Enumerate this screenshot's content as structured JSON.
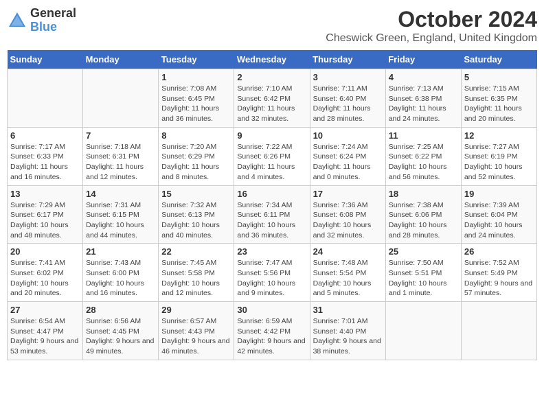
{
  "header": {
    "logo": {
      "text_general": "General",
      "text_blue": "Blue"
    },
    "title": "October 2024",
    "subtitle": "Cheswick Green, England, United Kingdom"
  },
  "calendar": {
    "days_of_week": [
      "Sunday",
      "Monday",
      "Tuesday",
      "Wednesday",
      "Thursday",
      "Friday",
      "Saturday"
    ],
    "weeks": [
      [
        {
          "day": "",
          "content": ""
        },
        {
          "day": "",
          "content": ""
        },
        {
          "day": "1",
          "content": "Sunrise: 7:08 AM\nSunset: 6:45 PM\nDaylight: 11 hours and 36 minutes."
        },
        {
          "day": "2",
          "content": "Sunrise: 7:10 AM\nSunset: 6:42 PM\nDaylight: 11 hours and 32 minutes."
        },
        {
          "day": "3",
          "content": "Sunrise: 7:11 AM\nSunset: 6:40 PM\nDaylight: 11 hours and 28 minutes."
        },
        {
          "day": "4",
          "content": "Sunrise: 7:13 AM\nSunset: 6:38 PM\nDaylight: 11 hours and 24 minutes."
        },
        {
          "day": "5",
          "content": "Sunrise: 7:15 AM\nSunset: 6:35 PM\nDaylight: 11 hours and 20 minutes."
        }
      ],
      [
        {
          "day": "6",
          "content": "Sunrise: 7:17 AM\nSunset: 6:33 PM\nDaylight: 11 hours and 16 minutes."
        },
        {
          "day": "7",
          "content": "Sunrise: 7:18 AM\nSunset: 6:31 PM\nDaylight: 11 hours and 12 minutes."
        },
        {
          "day": "8",
          "content": "Sunrise: 7:20 AM\nSunset: 6:29 PM\nDaylight: 11 hours and 8 minutes."
        },
        {
          "day": "9",
          "content": "Sunrise: 7:22 AM\nSunset: 6:26 PM\nDaylight: 11 hours and 4 minutes."
        },
        {
          "day": "10",
          "content": "Sunrise: 7:24 AM\nSunset: 6:24 PM\nDaylight: 11 hours and 0 minutes."
        },
        {
          "day": "11",
          "content": "Sunrise: 7:25 AM\nSunset: 6:22 PM\nDaylight: 10 hours and 56 minutes."
        },
        {
          "day": "12",
          "content": "Sunrise: 7:27 AM\nSunset: 6:19 PM\nDaylight: 10 hours and 52 minutes."
        }
      ],
      [
        {
          "day": "13",
          "content": "Sunrise: 7:29 AM\nSunset: 6:17 PM\nDaylight: 10 hours and 48 minutes."
        },
        {
          "day": "14",
          "content": "Sunrise: 7:31 AM\nSunset: 6:15 PM\nDaylight: 10 hours and 44 minutes."
        },
        {
          "day": "15",
          "content": "Sunrise: 7:32 AM\nSunset: 6:13 PM\nDaylight: 10 hours and 40 minutes."
        },
        {
          "day": "16",
          "content": "Sunrise: 7:34 AM\nSunset: 6:11 PM\nDaylight: 10 hours and 36 minutes."
        },
        {
          "day": "17",
          "content": "Sunrise: 7:36 AM\nSunset: 6:08 PM\nDaylight: 10 hours and 32 minutes."
        },
        {
          "day": "18",
          "content": "Sunrise: 7:38 AM\nSunset: 6:06 PM\nDaylight: 10 hours and 28 minutes."
        },
        {
          "day": "19",
          "content": "Sunrise: 7:39 AM\nSunset: 6:04 PM\nDaylight: 10 hours and 24 minutes."
        }
      ],
      [
        {
          "day": "20",
          "content": "Sunrise: 7:41 AM\nSunset: 6:02 PM\nDaylight: 10 hours and 20 minutes."
        },
        {
          "day": "21",
          "content": "Sunrise: 7:43 AM\nSunset: 6:00 PM\nDaylight: 10 hours and 16 minutes."
        },
        {
          "day": "22",
          "content": "Sunrise: 7:45 AM\nSunset: 5:58 PM\nDaylight: 10 hours and 12 minutes."
        },
        {
          "day": "23",
          "content": "Sunrise: 7:47 AM\nSunset: 5:56 PM\nDaylight: 10 hours and 9 minutes."
        },
        {
          "day": "24",
          "content": "Sunrise: 7:48 AM\nSunset: 5:54 PM\nDaylight: 10 hours and 5 minutes."
        },
        {
          "day": "25",
          "content": "Sunrise: 7:50 AM\nSunset: 5:51 PM\nDaylight: 10 hours and 1 minute."
        },
        {
          "day": "26",
          "content": "Sunrise: 7:52 AM\nSunset: 5:49 PM\nDaylight: 9 hours and 57 minutes."
        }
      ],
      [
        {
          "day": "27",
          "content": "Sunrise: 6:54 AM\nSunset: 4:47 PM\nDaylight: 9 hours and 53 minutes."
        },
        {
          "day": "28",
          "content": "Sunrise: 6:56 AM\nSunset: 4:45 PM\nDaylight: 9 hours and 49 minutes."
        },
        {
          "day": "29",
          "content": "Sunrise: 6:57 AM\nSunset: 4:43 PM\nDaylight: 9 hours and 46 minutes."
        },
        {
          "day": "30",
          "content": "Sunrise: 6:59 AM\nSunset: 4:42 PM\nDaylight: 9 hours and 42 minutes."
        },
        {
          "day": "31",
          "content": "Sunrise: 7:01 AM\nSunset: 4:40 PM\nDaylight: 9 hours and 38 minutes."
        },
        {
          "day": "",
          "content": ""
        },
        {
          "day": "",
          "content": ""
        }
      ]
    ]
  }
}
